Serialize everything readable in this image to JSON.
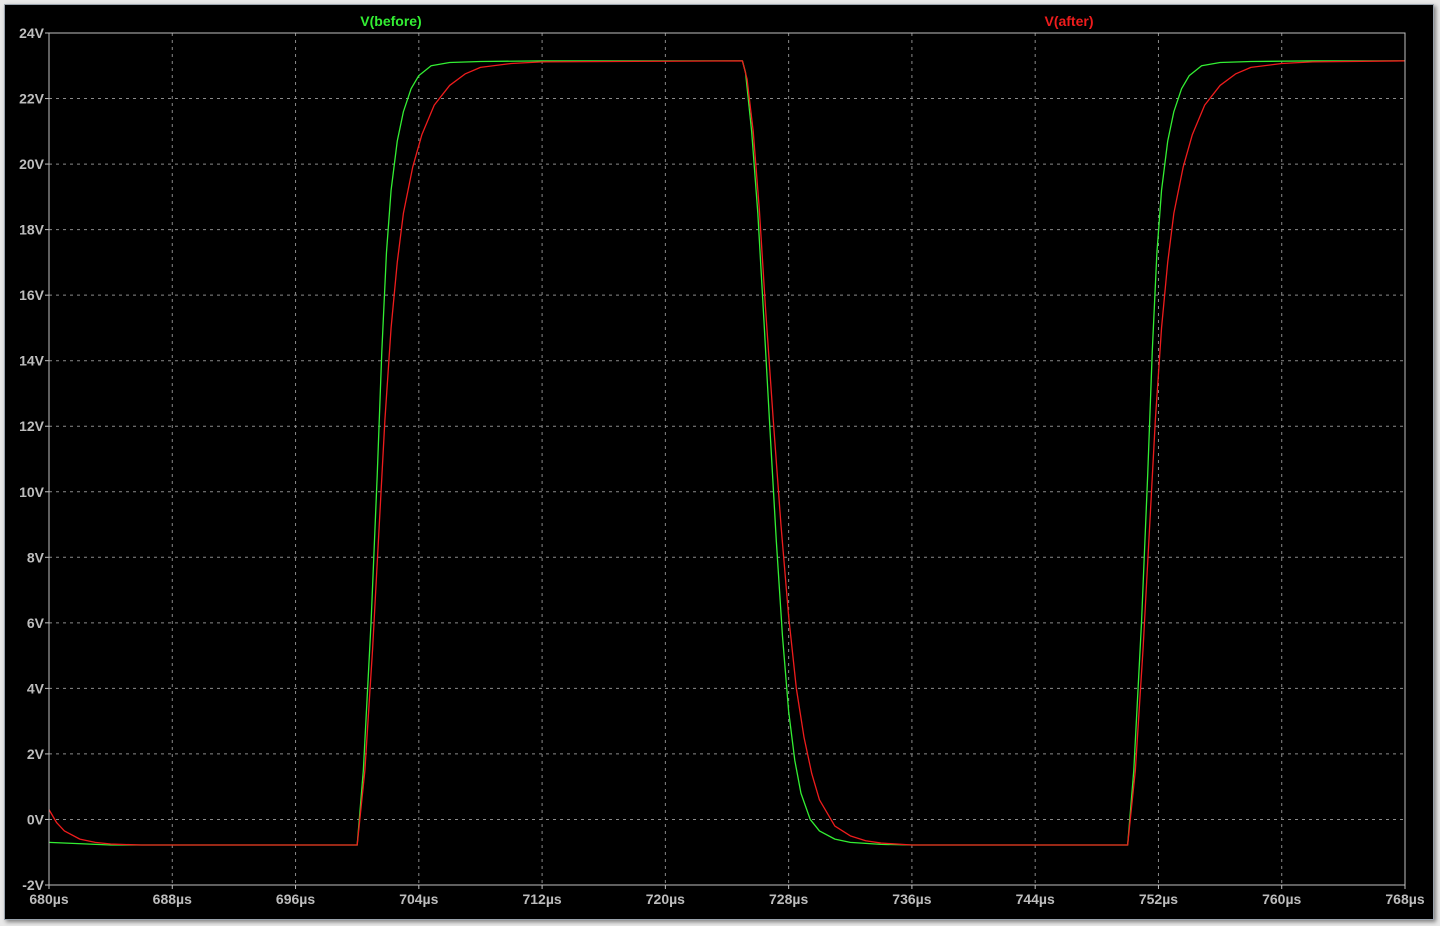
{
  "chart_data": {
    "type": "line",
    "title": "",
    "xlabel": "",
    "ylabel": "",
    "xlim": [
      680,
      768
    ],
    "ylim": [
      -2,
      24
    ],
    "grid": true,
    "x_ticks": [
      680,
      688,
      696,
      704,
      712,
      720,
      728,
      736,
      744,
      752,
      760,
      768
    ],
    "x_tick_labels": [
      "680µs",
      "688µs",
      "696µs",
      "704µs",
      "712µs",
      "720µs",
      "728µs",
      "736µs",
      "744µs",
      "752µs",
      "760µs",
      "768µs"
    ],
    "y_ticks": [
      -2,
      0,
      2,
      4,
      6,
      8,
      10,
      12,
      14,
      16,
      18,
      20,
      22,
      24
    ],
    "y_tick_labels": [
      "-2V",
      "0V",
      "2V",
      "4V",
      "6V",
      "8V",
      "10V",
      "12V",
      "14V",
      "16V",
      "18V",
      "20V",
      "22V",
      "24V"
    ],
    "colors": {
      "background": "#000000",
      "grid": "#8a8a8a",
      "tick_text": "#bdbdbd"
    },
    "series": [
      {
        "name": "V(before)",
        "color": "#33ee33",
        "x": [
          680,
          684,
          700,
          700.4,
          700.9,
          701.3,
          701.6,
          701.9,
          702.2,
          702.6,
          703.0,
          703.5,
          704.0,
          704.8,
          706.0,
          708.0,
          712.0,
          725,
          725.2,
          725.6,
          726.0,
          726.4,
          726.8,
          727.2,
          727.6,
          728.0,
          728.4,
          728.8,
          729.4,
          730.0,
          731.0,
          732.0,
          734.0,
          736.0,
          750,
          750.4,
          750.9,
          751.3,
          751.6,
          751.9,
          752.2,
          752.6,
          753.0,
          753.5,
          754.0,
          754.8,
          756.0,
          758.0,
          762.0,
          768
        ],
        "y": [
          -0.7,
          -0.78,
          -0.78,
          1.5,
          6.0,
          10.5,
          14.3,
          17.3,
          19.2,
          20.7,
          21.6,
          22.3,
          22.7,
          23.0,
          23.1,
          23.13,
          23.15,
          23.15,
          22.8,
          21.0,
          18.5,
          15.2,
          11.8,
          8.5,
          5.6,
          3.3,
          1.8,
          0.8,
          0.0,
          -0.35,
          -0.6,
          -0.7,
          -0.76,
          -0.78,
          -0.78,
          1.5,
          6.0,
          10.5,
          14.3,
          17.3,
          19.2,
          20.7,
          21.6,
          22.3,
          22.7,
          23.0,
          23.1,
          23.13,
          23.15,
          23.15
        ]
      },
      {
        "name": "V(after)",
        "color": "#ee1c1c",
        "x": [
          680,
          680.5,
          681,
          682,
          683,
          684,
          686,
          688,
          700,
          700.5,
          701.0,
          701.4,
          701.8,
          702.2,
          702.6,
          703.0,
          703.6,
          704.2,
          705.0,
          706.0,
          707.0,
          708.0,
          710.0,
          712.0,
          725,
          725.3,
          725.7,
          726.1,
          726.5,
          727.0,
          727.5,
          728.0,
          728.5,
          729.0,
          729.5,
          730.0,
          731.0,
          732.0,
          733.0,
          734.0,
          736.0,
          750,
          750.5,
          751.0,
          751.4,
          751.8,
          752.2,
          752.6,
          753.0,
          753.6,
          754.2,
          755.0,
          756.0,
          757.0,
          758.0,
          760.0,
          762.0,
          768
        ],
        "y": [
          0.3,
          -0.1,
          -0.35,
          -0.6,
          -0.7,
          -0.75,
          -0.78,
          -0.78,
          -0.78,
          1.5,
          5.2,
          8.7,
          12.2,
          15.0,
          17.0,
          18.5,
          19.9,
          20.9,
          21.8,
          22.4,
          22.75,
          22.95,
          23.07,
          23.12,
          23.15,
          22.6,
          21.0,
          18.6,
          15.6,
          12.2,
          9.0,
          6.2,
          4.0,
          2.5,
          1.4,
          0.6,
          -0.2,
          -0.5,
          -0.65,
          -0.72,
          -0.78,
          -0.78,
          1.5,
          5.2,
          8.7,
          12.2,
          15.0,
          17.0,
          18.5,
          19.9,
          20.9,
          21.8,
          22.4,
          22.75,
          22.95,
          23.07,
          23.12,
          23.15
        ]
      }
    ]
  }
}
